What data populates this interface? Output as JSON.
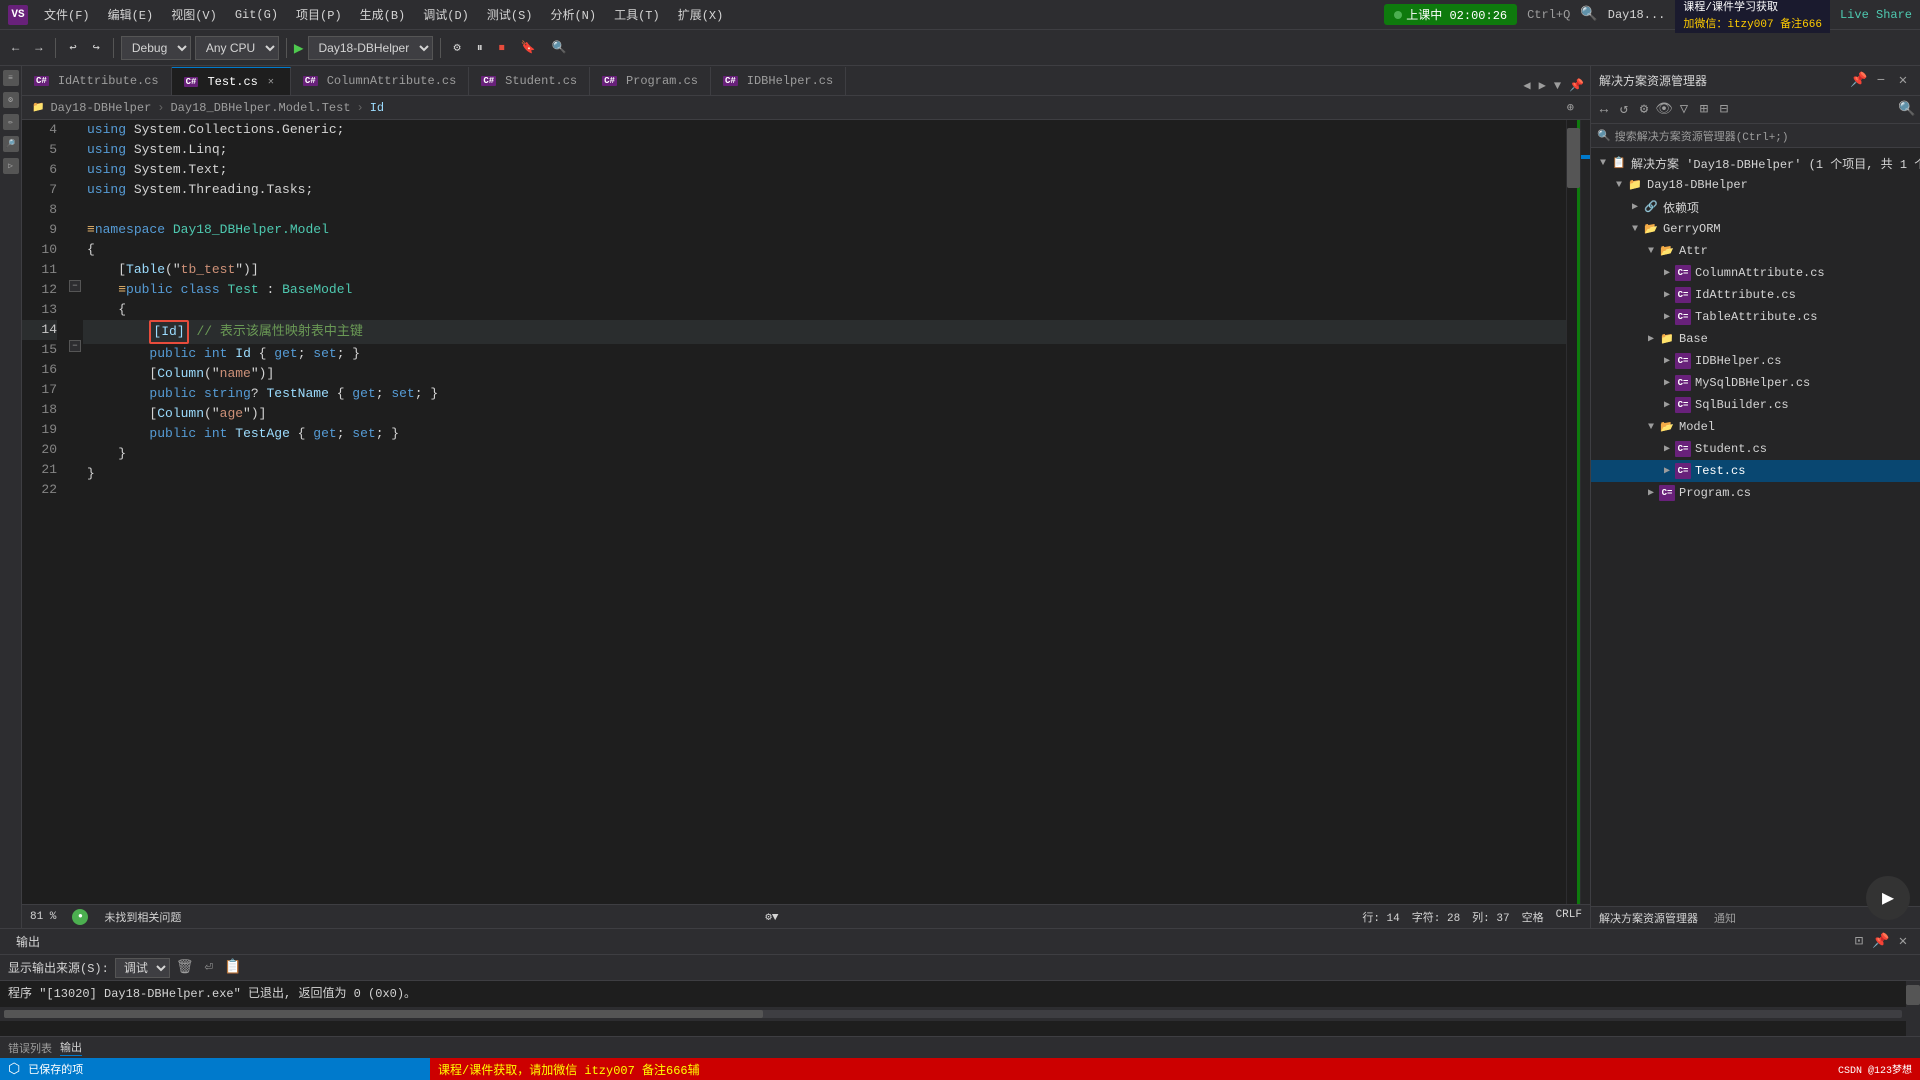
{
  "menubar": {
    "logo": "VS",
    "items": [
      "文件(F)",
      "编辑(E)",
      "视图(V)",
      "Git(G)",
      "项目(P)",
      "生成(B)",
      "调试(D)",
      "测试(S)",
      "分析(N)",
      "工具(T)",
      "扩展(X)"
    ],
    "timer": "上课中 02:00:26",
    "shortcut": "Ctrl+Q",
    "title": "Day18...",
    "branding_line1": "课程/课件学习获取",
    "branding_line2": "加微信：itzy007  备注666",
    "live_share": "Live Share"
  },
  "toolbar": {
    "debug_dropdown": "Debug",
    "platform_dropdown": "Any CPU",
    "project_dropdown": "Day18-DBHelper",
    "back_btn": "←",
    "forward_btn": "→"
  },
  "tabs": [
    {
      "label": "IdAttribute.cs",
      "active": false,
      "closable": false
    },
    {
      "label": "Test.cs",
      "active": true,
      "closable": true
    },
    {
      "label": "ColumnAttribute.cs",
      "active": false,
      "closable": false
    },
    {
      "label": "Student.cs",
      "active": false,
      "closable": false
    },
    {
      "label": "Program.cs",
      "active": false,
      "closable": false
    },
    {
      "label": "IDBHelper.cs",
      "active": false,
      "closable": false
    }
  ],
  "breadcrumb": {
    "project": "Day18-DBHelper",
    "sep1": "›",
    "path": "Day18_DBHelper.Model.Test",
    "sep2": "›",
    "member": "Id"
  },
  "code": {
    "lines": [
      {
        "num": 4,
        "content": "using System.Collections.Generic;",
        "tokens": [
          {
            "type": "kw",
            "text": "using"
          },
          {
            "type": "plain",
            "text": " System.Collections.Generic;"
          }
        ]
      },
      {
        "num": 5,
        "content": "using System.Linq;",
        "tokens": [
          {
            "type": "kw",
            "text": "using"
          },
          {
            "type": "plain",
            "text": " System.Linq;"
          }
        ]
      },
      {
        "num": 6,
        "content": "using System.Text;",
        "tokens": [
          {
            "type": "kw",
            "text": "using"
          },
          {
            "type": "plain",
            "text": " System.Text;"
          }
        ]
      },
      {
        "num": 7,
        "content": "using System.Threading.Tasks;",
        "tokens": [
          {
            "type": "kw",
            "text": "using"
          },
          {
            "type": "plain",
            "text": " System.Threading.Tasks;"
          }
        ]
      },
      {
        "num": 8,
        "content": ""
      },
      {
        "num": 9,
        "content": "namespace Day18_DBHelper.Model",
        "tokens": [
          {
            "type": "kw",
            "text": "namespace"
          },
          {
            "type": "plain",
            "text": " "
          },
          {
            "type": "ns",
            "text": "Day18_DBHelper.Model"
          }
        ]
      },
      {
        "num": 10,
        "content": "{"
      },
      {
        "num": 11,
        "content": "    [Table(\"tb_test\")]",
        "tokens": [
          {
            "type": "plain",
            "text": "    ["
          },
          {
            "type": "attr",
            "text": "Table"
          },
          {
            "type": "plain",
            "text": "(\"tb_test\")]"
          }
        ]
      },
      {
        "num": 12,
        "content": "    public class Test : BaseModel",
        "tokens": [
          {
            "type": "plain",
            "text": "    "
          },
          {
            "type": "kw",
            "text": "public"
          },
          {
            "type": "plain",
            "text": " "
          },
          {
            "type": "kw",
            "text": "class"
          },
          {
            "type": "plain",
            "text": " "
          },
          {
            "type": "class",
            "text": "Test"
          },
          {
            "type": "plain",
            "text": " : "
          },
          {
            "type": "type",
            "text": "BaseModel"
          }
        ]
      },
      {
        "num": 13,
        "content": "    {"
      },
      {
        "num": 14,
        "content": "        [Id] // 表示该属性映射表中主键",
        "active": true,
        "highlight": true
      },
      {
        "num": 15,
        "content": "        public int Id { get; set; }"
      },
      {
        "num": 16,
        "content": "        [Column(\"name\")]"
      },
      {
        "num": 17,
        "content": "        public string? TestName { get; set; }"
      },
      {
        "num": 18,
        "content": "        [Column(\"age\")]"
      },
      {
        "num": 19,
        "content": "        public int TestAge { get; set; }"
      },
      {
        "num": 20,
        "content": "    }"
      },
      {
        "num": 21,
        "content": "}"
      },
      {
        "num": 22,
        "content": ""
      }
    ]
  },
  "status_bar": {
    "git": "已保存的项",
    "line": "行: 14",
    "col": "字符: 28",
    "pos": "列: 37",
    "indent": "空格",
    "encoding": "CRLF",
    "no_issues": "未找到相关问题",
    "zoom": "81 %"
  },
  "solution_explorer": {
    "title": "解决方案资源管理器",
    "search_placeholder": "搜索解决方案资源管理器(Ctrl+;)",
    "solution_label": "解决方案 'Day18-DBHelper' (1 个项目, 共 1 个)",
    "project": {
      "name": "Day18-DBHelper",
      "items": [
        {
          "type": "ref",
          "label": "依赖项",
          "indent": 2
        },
        {
          "type": "folder",
          "label": "GerryORM",
          "indent": 2,
          "expanded": true
        },
        {
          "type": "folder",
          "label": "Attr",
          "indent": 3,
          "expanded": true
        },
        {
          "type": "file",
          "label": "ColumnAttribute.cs",
          "indent": 4
        },
        {
          "type": "file",
          "label": "IdAttribute.cs",
          "indent": 4
        },
        {
          "type": "file",
          "label": "TableAttribute.cs",
          "indent": 4
        },
        {
          "type": "folder",
          "label": "Base",
          "indent": 3,
          "expanded": false
        },
        {
          "type": "file",
          "label": "IDBHelper.cs",
          "indent": 4
        },
        {
          "type": "file",
          "label": "MySqlDBHelper.cs",
          "indent": 4
        },
        {
          "type": "file",
          "label": "SqlBuilder.cs",
          "indent": 4
        },
        {
          "type": "folder",
          "label": "Model",
          "indent": 3,
          "expanded": true
        },
        {
          "type": "file",
          "label": "Student.cs",
          "indent": 4
        },
        {
          "type": "file",
          "label": "Test.cs",
          "indent": 4,
          "selected": true
        },
        {
          "type": "file",
          "label": "Program.cs",
          "indent": 3
        }
      ]
    }
  },
  "output_panel": {
    "title": "输出",
    "source_label": "显示输出来源(S):",
    "source_value": "调试",
    "content": "程序 \"[13020] Day18-DBHelper.exe\" 已退出, 返回值为 0 (0x0)。",
    "tabs": [
      "错误列表",
      "输出"
    ]
  },
  "bottom_banner": {
    "text": "课程/课件获取，请加微信 itzy007  备注666辅"
  }
}
